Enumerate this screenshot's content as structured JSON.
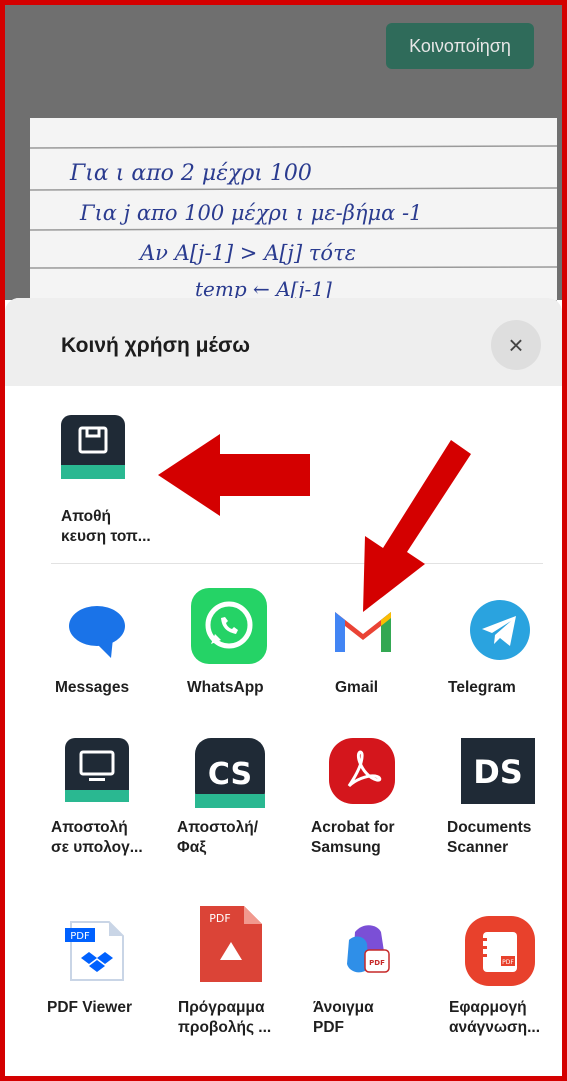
{
  "top_bar": {
    "share_button_label": "Κοινοποίηση"
  },
  "sheet": {
    "title": "Κοινή χρήση μέσω",
    "close_icon": "×"
  },
  "save_row": {
    "app": {
      "label": "Αποθή\nκευση τοπ...",
      "icon": "save-local-icon",
      "color": "#1f2a36",
      "accent": "#2ab891"
    }
  },
  "apps": [
    {
      "label": "Messages",
      "icon": "messages-icon",
      "color": "#1a73e8"
    },
    {
      "label": "WhatsApp",
      "icon": "whatsapp-icon",
      "color": "#25d366"
    },
    {
      "label": "Gmail",
      "icon": "gmail-icon",
      "color": "#ea4335"
    },
    {
      "label": "Telegram",
      "icon": "telegram-icon",
      "color": "#2aa3df"
    },
    {
      "label": "Αποστολή\nσε υπολογ...",
      "icon": "send-to-pc-icon",
      "color": "#1f2a36"
    },
    {
      "label": "Αποστολή/\nΦαξ",
      "icon": "camscanner-icon",
      "color": "#1f2a36",
      "icon_text": "CS"
    },
    {
      "label": "Acrobat for\nSamsung",
      "icon": "acrobat-icon",
      "color": "#d4161c"
    },
    {
      "label": "Documents\nScanner",
      "icon": "documents-scanner-icon",
      "color": "#1f2a36",
      "icon_text": "DS"
    },
    {
      "label": "PDF Viewer",
      "icon": "pdf-viewer-icon",
      "color": "#0061fe",
      "icon_text": "PDF"
    },
    {
      "label": "Πρόγραμμα\nπροβολής ...",
      "icon": "google-pdf-viewer-icon",
      "color": "#db4437",
      "icon_text": "PDF"
    },
    {
      "label": "Άνοιγμα\nPDF",
      "icon": "open-pdf-icon",
      "color": "#7b4fd6",
      "icon_text": "PDF"
    },
    {
      "label": "Εφαρμογή\nανάγνωση...",
      "icon": "samsung-notes-pdf-icon",
      "color": "#e8412c",
      "icon_text": "PDF"
    }
  ],
  "handwriting_lines": [
    "Για  ι  απο  2  μέχρι  100",
    "Για  j  απο  100  μέχρι  ι  με-βήμα -1",
    "Αν  Α[j-1] > Α[j]  τότε",
    "temp ← Α[j-1]"
  ],
  "colors": {
    "highlight_red": "#d40000",
    "share_button": "#2f6b5a"
  }
}
